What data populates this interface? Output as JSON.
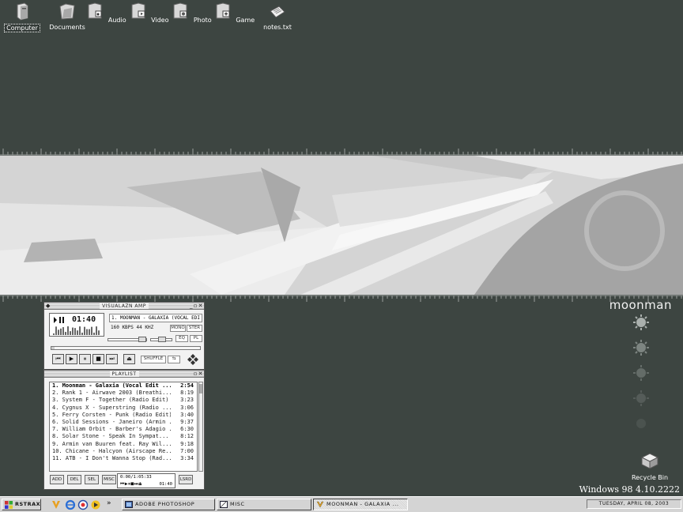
{
  "desktop": {
    "icons": [
      {
        "label": "Computer",
        "icon": "computer-icon"
      },
      {
        "label": "Documents",
        "icon": "documents-folder-icon"
      },
      {
        "label": "Audio",
        "icon": "audio-folder-icon"
      },
      {
        "label": "Video",
        "icon": "video-folder-icon"
      },
      {
        "label": "Photo",
        "icon": "photo-folder-icon"
      },
      {
        "label": "Game",
        "icon": "game-folder-icon"
      },
      {
        "label": "notes.txt",
        "icon": "text-file-icon"
      }
    ],
    "recycle_bin": "Recycle Bin",
    "brand": "moonman",
    "version": "Windows 98 4.10.2222"
  },
  "player": {
    "title": "VISUALAZN AMP",
    "time": "01:40",
    "ticker": "1. MOONMAN - GALAXIA (VOCAL EDI",
    "bitrate": "160 KBPS  44 KHZ",
    "mono": "MONO",
    "stereo": "STER",
    "eq": "EQ",
    "pl": "PL",
    "shuffle": "SHUFFLE"
  },
  "playlist": {
    "title": "PLAYLIST",
    "tracks": [
      {
        "title": "1. Moonman - Galaxia (Vocal Edit ...",
        "time": "2:54"
      },
      {
        "title": "2. Rank 1 - Airwave 2003 (Breathi...",
        "time": "8:19"
      },
      {
        "title": "3. System F - Together (Radio Edit)",
        "time": "3:23"
      },
      {
        "title": "4. Cygnus X - Superstring (Radio ...",
        "time": "3:06"
      },
      {
        "title": "5. Ferry Corsten - Punk (Radio Edit)",
        "time": "3:40"
      },
      {
        "title": "6. Solid Sessions - Janeiro (Armin ...",
        "time": "9:37"
      },
      {
        "title": "7. William Orbit - Barber's Adagio ...",
        "time": "6:30"
      },
      {
        "title": "8. Solar Stone - Speak In Sympat...",
        "time": "8:12"
      },
      {
        "title": "9. Armin van Buuren feat. Ray Wil...",
        "time": "9:18"
      },
      {
        "title": "10. Chicane - Halcyon (Airscape Re...",
        "time": "7:00"
      },
      {
        "title": "11. ATB - I Don't Wanna Stop (Rad...",
        "time": "3:34"
      }
    ],
    "buttons": {
      "add": "ADD",
      "del": "DEL",
      "sel": "SEL",
      "misc": "MISC",
      "list": "LSRD"
    },
    "mini_time": "0:00/1:05:33",
    "mini_elapsed": "01:40"
  },
  "taskbar": {
    "start": "RSTRAX",
    "more": "»",
    "tasks": [
      "ADOBE PHOTOSHOP",
      "MISC",
      "MOONMAN - GALAXIA ..."
    ],
    "clock": "TUESDAY, APRIL 08, 2003"
  },
  "colors": {
    "desktop": "#3d4541",
    "banner": "#d2d2d2",
    "taskbar": "#d4d4d4"
  }
}
